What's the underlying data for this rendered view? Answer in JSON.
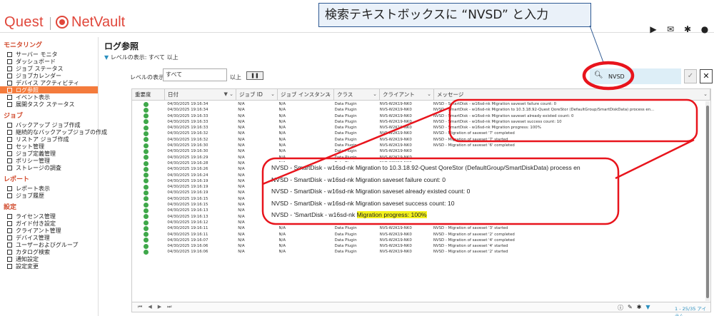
{
  "header": {
    "logo_left": "Quest",
    "logo_right": "NetVault",
    "callout": "検索テキストボックスに “NVSD” と入力",
    "icons": [
      "video-icon",
      "chat-icon",
      "puzzle-icon",
      "user-icon"
    ]
  },
  "sidebar": {
    "sections": [
      {
        "title": "モニタリング",
        "items": [
          "サーバー モニタ",
          "ダッシュボード",
          "ジョブ ステータス",
          "ジョブカレンダー",
          "デバイス アクティビティ",
          "ログ参照",
          "イベント表示",
          "展開タスク ステータス"
        ]
      },
      {
        "title": "ジョブ",
        "items": [
          "バックアップ ジョブ作成",
          "継続的なバックアップジョブの作成",
          "リストア ジョブ作成",
          "セット管理",
          "ジョブ定義管理",
          "ポリシー管理",
          "ストレージの調査"
        ]
      },
      {
        "title": "レポート",
        "items": [
          "レポート表示",
          "ジョブ履歴"
        ]
      },
      {
        "title": "設定",
        "items": [
          "ライセンス管理",
          "ガイド付き設定",
          "クライアント管理",
          "デバイス管理",
          "ユーザーおよびグループ",
          "カタログ検索",
          "通知設定",
          "設定変更"
        ]
      }
    ],
    "active": "ログ参照"
  },
  "page": {
    "title": "ログ参照",
    "level_line": "レベルの表示: すべて 以上",
    "level_label": "レベルの表示",
    "level_value": "すべて",
    "above_label": "以上",
    "pause_label": "❚❚"
  },
  "search": {
    "value": "NVSD",
    "ok_label": "✓",
    "clear_label": "✕"
  },
  "table": {
    "columns": [
      "重要度",
      "日付",
      "ジョブ ID",
      "ジョブ インスタンス",
      "クラス",
      "クライアント",
      "メッセージ"
    ],
    "rows": [
      [
        "04/30/2025 19:16:34",
        "N/A",
        "N/A",
        "Data Plugin",
        "NVS-W2K19-NK0",
        "NVSD - SmartDisk - w16sd-nk Migration saveset failure count: 0"
      ],
      [
        "04/30/2025 19:16:34",
        "N/A",
        "N/A",
        "Data Plugin",
        "NVS-W2K19-NK0",
        "NVSD - SmartDisk - w16sd-nk Migration to 10.3.18.92-Quest QoreStor (DefaultGroup/SmartDiskData) process en..."
      ],
      [
        "04/30/2025 19:16:33",
        "N/A",
        "N/A",
        "Data Plugin",
        "NVS-W2K19-NK0",
        "NVSD - SmartDisk - w16sd-nk Migration saveset already existed count: 0"
      ],
      [
        "04/30/2025 19:16:33",
        "N/A",
        "N/A",
        "Data Plugin",
        "NVS-W2K19-NK0",
        "NVSD - SmartDisk - w16sd-nk Migration saveset success count: 10"
      ],
      [
        "04/30/2025 19:16:33",
        "N/A",
        "N/A",
        "Data Plugin",
        "NVS-W2K19-NK0",
        "NVSD - SmartDisk - w16sd-nk Migration progress: 100%"
      ],
      [
        "04/30/2025 19:16:32",
        "N/A",
        "N/A",
        "Data Plugin",
        "NVS-W2K19-NK0",
        "NVSD - Migration of saveset '7' completed"
      ],
      [
        "04/30/2025 19:16:32",
        "N/A",
        "N/A",
        "Data Plugin",
        "NVS-W2K19-NK0",
        "NVSD - Migration of saveset '7' started"
      ],
      [
        "04/30/2025 19:16:30",
        "N/A",
        "N/A",
        "Data Plugin",
        "NVS-W2K19-NK0",
        "NVSD - Migration of saveset '6' completed"
      ],
      [
        "04/30/2025 19:16:30",
        "N/A",
        "N/A",
        "Data Plugin",
        "NVS-W2K19-NK0",
        ""
      ],
      [
        "04/30/2025 19:16:29",
        "N/A",
        "N/A",
        "Data Plugin",
        "NVS-W2K19-NK0",
        ""
      ],
      [
        "04/30/2025 19:16:28",
        "N/A",
        "N/A",
        "Data Plugin",
        "NVS-W2K19-NK0",
        ""
      ],
      [
        "04/30/2025 19:16:26",
        "N/A",
        "N/A",
        "Data Plugin",
        "NVS-W2K19-NK0",
        ""
      ],
      [
        "04/30/2025 19:16:24",
        "N/A",
        "N/A",
        "Data Plugin",
        "NVS-W2K19-NK0",
        ""
      ],
      [
        "04/30/2025 19:16:19",
        "N/A",
        "N/A",
        "Data Plugin",
        "NVS-W2K19-NK0",
        ""
      ],
      [
        "04/30/2025 19:16:19",
        "N/A",
        "N/A",
        "Data Plugin",
        "NVS-W2K19-NK0",
        ""
      ],
      [
        "04/30/2025 19:16:19",
        "N/A",
        "N/A",
        "Data Plugin",
        "NVS-W2K19-NK0",
        "NVSD - Migration of saveset '5' completed"
      ],
      [
        "04/30/2025 19:16:15",
        "N/A",
        "N/A",
        "Data Plugin",
        "NVS-W2K19-NK0",
        "NVSD - Migration of saveset '5' started"
      ],
      [
        "04/30/2025 19:16:15",
        "N/A",
        "N/A",
        "Data Plugin",
        "NVS-W2K19-NK0",
        "NVSD - Migration of saveset '1' completed"
      ],
      [
        "04/30/2025 19:16:13",
        "N/A",
        "N/A",
        "Data Plugin",
        "NVS-W2K19-NK0",
        "NVSD - Migration of saveset '1' started"
      ],
      [
        "04/30/2025 19:16:13",
        "N/A",
        "N/A",
        "Data Plugin",
        "NVS-W2K19-NK0",
        "NVSD - SmartDisk - w16sd-nk Migration progress: 40%"
      ],
      [
        "04/30/2025 19:16:12",
        "N/A",
        "N/A",
        "Data Plugin",
        "NVS-W2K19-NK0",
        "NVSD - Migration of saveset '3' completed"
      ],
      [
        "04/30/2025 19:16:11",
        "N/A",
        "N/A",
        "Data Plugin",
        "NVS-W2K19-NK0",
        "NVSD - Migration of saveset '3' started"
      ],
      [
        "04/30/2025 19:16:11",
        "N/A",
        "N/A",
        "Data Plugin",
        "NVS-W2K19-NK0",
        "NVSD - Migration of saveset '2' completed"
      ],
      [
        "04/30/2025 19:16:07",
        "N/A",
        "N/A",
        "Data Plugin",
        "NVS-W2K19-NK0",
        "NVSD - Migration of saveset '4' completed"
      ],
      [
        "04/30/2025 19:16:06",
        "N/A",
        "N/A",
        "Data Plugin",
        "NVS-W2K19-NK0",
        "NVSD - Migration of saveset '4' started"
      ],
      [
        "04/30/2025 19:16:06",
        "N/A",
        "N/A",
        "Data Plugin",
        "NVS-W2K19-NK0",
        "NVSD - Migration of saveset '2' started"
      ]
    ],
    "severity_color": "#3fa84a",
    "footer_count": "1 - 25/35 アイテム"
  },
  "zoom": {
    "lines": [
      "NVSD - SmartDisk - w16sd-nk Migration to 10.3.18.92-Quest QoreStor (DefaultGroup/SmartDiskData) process en",
      "NVSD - SmartDisk - w16sd-nk Migration saveset failure count: 0",
      "NVSD - SmartDisk - w16sd-nk Migration saveset already existed count: 0",
      "NVSD - SmartDisk - w16sd-nk Migration saveset success count: 10"
    ],
    "last_prefix": "NVSD - 'SmartDisk - w16sd-nk",
    "last_highlight": "Migration progress: 100%"
  },
  "colors": {
    "accent": "#f47b3c",
    "annotation": "#e8141c",
    "brand": "#e0463a"
  }
}
